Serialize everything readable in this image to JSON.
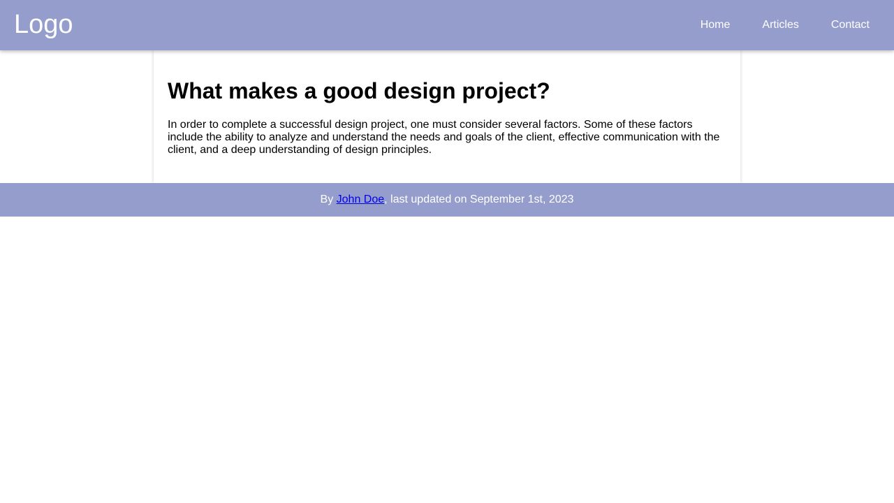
{
  "header": {
    "logo_text": "Logo",
    "nav": {
      "home": "Home",
      "articles": "Articles",
      "contact": "Contact"
    }
  },
  "article": {
    "title": "What makes a good design project?",
    "body": "In order to complete a successful design project, one must consider several factors. Some of these factors include the ability to analyze and understand the needs and goals of the client, effective communication with the client, and a deep understanding of design principles."
  },
  "footer": {
    "prefix": "By ",
    "author": "John Doe",
    "suffix": ", last updated on September 1st, 2023"
  },
  "colors": {
    "header_background": "#949dcb",
    "footer_background": "#949dcb",
    "link": "#0000ee"
  }
}
